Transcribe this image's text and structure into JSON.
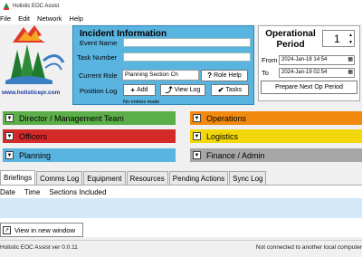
{
  "window": {
    "title": "Holistic EOC Assist"
  },
  "menu": [
    "File",
    "Edit",
    "Network",
    "Help"
  ],
  "logo": {
    "url": "www.holisticepr.com"
  },
  "incident": {
    "title": "Incident Information",
    "event_name_label": "Event Name",
    "event_name_value": "",
    "task_number_label": "Task Number",
    "task_number_value": "",
    "current_role_label": "Current Role",
    "current_role_value": "Planning Section Ch",
    "role_help_label": "Role Help",
    "position_log_label": "Position Log",
    "add_label": "Add",
    "view_log_label": "View Log",
    "tasks_label": "Tasks",
    "no_entries": "No entries made"
  },
  "period": {
    "title": "Operational Period",
    "number": "1",
    "from_label": "From",
    "from_value": "2024-Jan-18 14:54",
    "to_label": "To",
    "to_value": "2024-Jan-19 02:54",
    "prepare_label": "Prepare Next Op Period"
  },
  "sections": [
    {
      "label": "Director / Management Team",
      "color": "#5cae48"
    },
    {
      "label": "Operations",
      "color": "#f28a0f"
    },
    {
      "label": "Officers",
      "color": "#d42a2a"
    },
    {
      "label": "Logistics",
      "color": "#f2d80a"
    },
    {
      "label": "Planning",
      "color": "#5ab4e0"
    },
    {
      "label": "Finance / Admin",
      "color": "#a6a6a6"
    }
  ],
  "tabs": [
    "Briefings",
    "Comms Log",
    "Equipment",
    "Resources",
    "Pending Actions",
    "Sync Log"
  ],
  "briefings": {
    "columns": [
      "Date",
      "Time",
      "Sections Included"
    ],
    "view_window_label": "View in new window"
  },
  "status": {
    "version": "Holistic EOC Assist ver 0.0.11",
    "connection": "Not connected to another local computer"
  }
}
